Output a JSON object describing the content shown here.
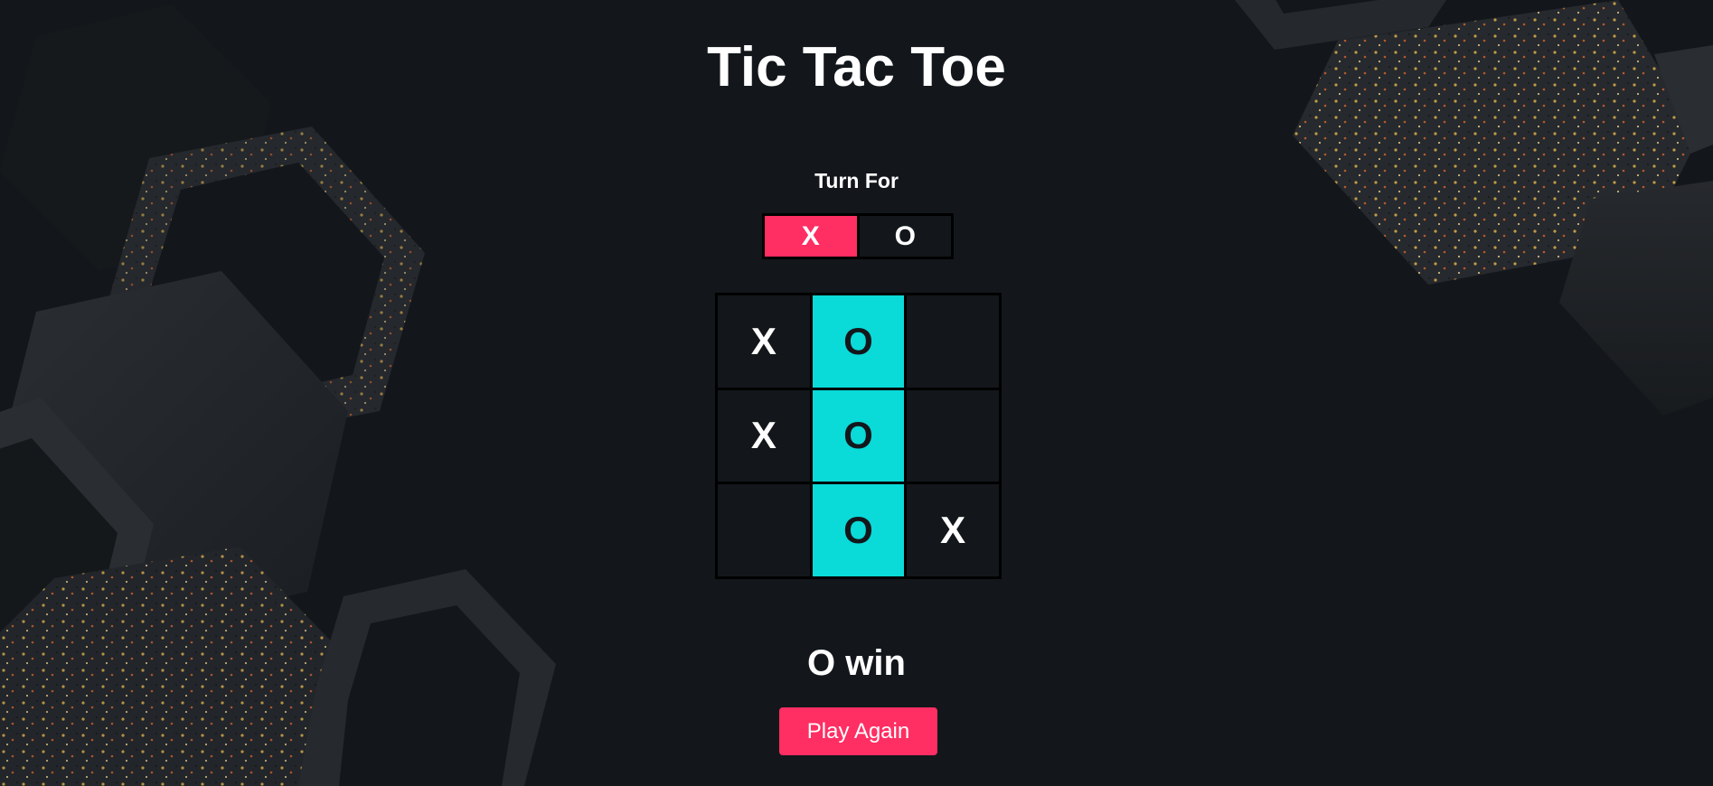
{
  "app": {
    "title": "Tic Tac Toe"
  },
  "turn": {
    "label": "Turn For",
    "options": [
      "X",
      "O"
    ],
    "active": "X"
  },
  "board": {
    "cells": [
      "X",
      "O",
      "",
      "X",
      "O",
      "",
      "",
      "O",
      "X"
    ],
    "winning_cells": [
      1,
      4,
      7
    ]
  },
  "result": {
    "text": "O win"
  },
  "actions": {
    "play_again_label": "Play Again"
  },
  "colors": {
    "background": "#13171b",
    "accent_pink": "#ff2e63",
    "win_cyan": "#0adad8",
    "grid_line": "#000000",
    "text": "#ffffff"
  }
}
